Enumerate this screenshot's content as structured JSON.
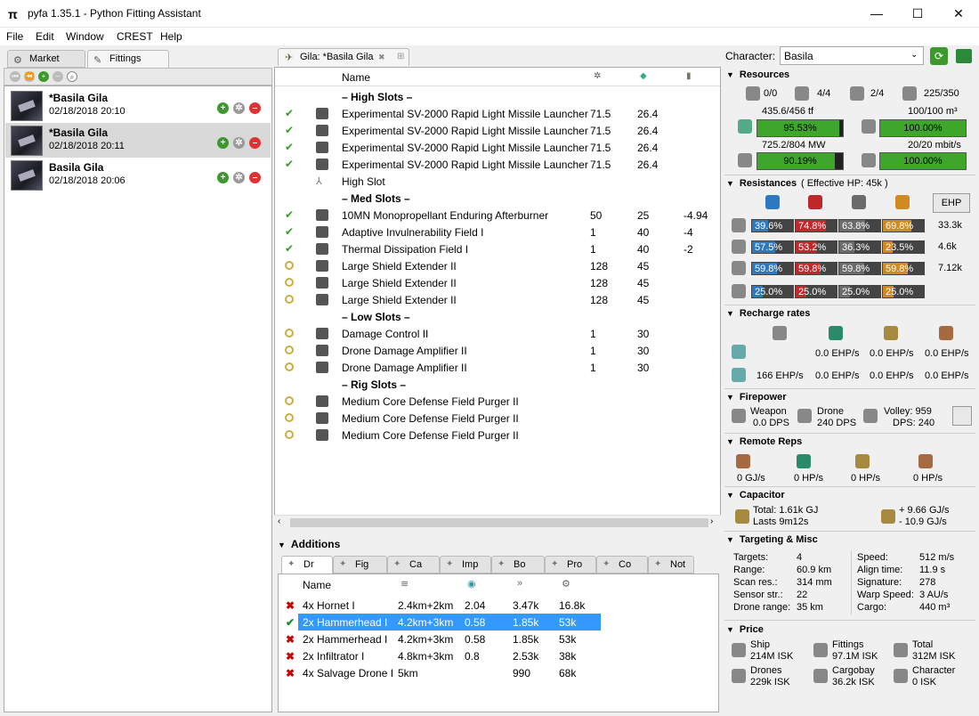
{
  "window": {
    "title": "pyfa 1.35.1 - Python Fitting Assistant",
    "minimize": "—",
    "maximize": "☐",
    "close": "✕"
  },
  "menu": [
    "File",
    "Edit",
    "Window",
    "CREST",
    "Help"
  ],
  "left": {
    "tabs": [
      "Market",
      "Fittings"
    ],
    "fits": [
      {
        "name": "*Basila Gila",
        "date": "02/18/2018 20:10"
      },
      {
        "name": "*Basila Gila",
        "date": "02/18/2018 20:11"
      },
      {
        "name": "Basila Gila",
        "date": "02/18/2018 20:06"
      }
    ]
  },
  "fit_tab": {
    "label": "Gila: *Basila Gila"
  },
  "modules": {
    "header": {
      "name": "Name"
    },
    "rows": [
      {
        "type": "header",
        "name": "– High Slots –"
      },
      {
        "state": "on",
        "name": "Experimental SV-2000 Rapid Light Missile Launcher",
        "c1": "71.5",
        "c2": "26.4",
        "c3": ""
      },
      {
        "state": "on",
        "name": "Experimental SV-2000 Rapid Light Missile Launcher",
        "c1": "71.5",
        "c2": "26.4",
        "c3": ""
      },
      {
        "state": "on",
        "name": "Experimental SV-2000 Rapid Light Missile Launcher",
        "c1": "71.5",
        "c2": "26.4",
        "c3": ""
      },
      {
        "state": "on",
        "name": "Experimental SV-2000 Rapid Light Missile Launcher",
        "c1": "71.5",
        "c2": "26.4",
        "c3": ""
      },
      {
        "state": "empty",
        "name": "High Slot",
        "c1": "",
        "c2": "",
        "c3": ""
      },
      {
        "type": "header",
        "name": "– Med Slots –"
      },
      {
        "state": "on",
        "name": "10MN Monopropellant Enduring Afterburner",
        "c1": "50",
        "c2": "25",
        "c3": "-4.94"
      },
      {
        "state": "on",
        "name": "Adaptive Invulnerability Field I",
        "c1": "1",
        "c2": "40",
        "c3": "-4"
      },
      {
        "state": "on",
        "name": "Thermal Dissipation Field I",
        "c1": "1",
        "c2": "40",
        "c3": "-2"
      },
      {
        "state": "off",
        "name": "Large Shield Extender II",
        "c1": "128",
        "c2": "45",
        "c3": ""
      },
      {
        "state": "off",
        "name": "Large Shield Extender II",
        "c1": "128",
        "c2": "45",
        "c3": ""
      },
      {
        "state": "off",
        "name": "Large Shield Extender II",
        "c1": "128",
        "c2": "45",
        "c3": ""
      },
      {
        "type": "header",
        "name": "– Low Slots –"
      },
      {
        "state": "off",
        "name": "Damage Control II",
        "c1": "1",
        "c2": "30",
        "c3": ""
      },
      {
        "state": "off",
        "name": "Drone Damage Amplifier II",
        "c1": "1",
        "c2": "30",
        "c3": ""
      },
      {
        "state": "off",
        "name": "Drone Damage Amplifier II",
        "c1": "1",
        "c2": "30",
        "c3": ""
      },
      {
        "type": "header",
        "name": "– Rig Slots –"
      },
      {
        "state": "off",
        "name": "Medium Core Defense Field Purger II",
        "c1": "",
        "c2": "",
        "c3": ""
      },
      {
        "state": "off",
        "name": "Medium Core Defense Field Purger II",
        "c1": "",
        "c2": "",
        "c3": ""
      },
      {
        "state": "off",
        "name": "Medium Core Defense Field Purger II",
        "c1": "",
        "c2": "",
        "c3": ""
      }
    ]
  },
  "additions": {
    "title": "Additions",
    "tabs": [
      "Dr",
      "Fig",
      "Ca",
      "Imp",
      "Bo",
      "Pro",
      "Co",
      "Not"
    ],
    "header": {
      "name": "Name"
    },
    "rows": [
      {
        "name": "4x Hornet I",
        "range": "2.4km+2km",
        "speed": "2.04",
        "a": "3.47k",
        "b": "16.8k",
        "selected": false
      },
      {
        "name": "2x Hammerhead I",
        "range": "4.2km+3km",
        "speed": "0.58",
        "a": "1.85k",
        "b": "53k",
        "selected": true
      },
      {
        "name": "2x Hammerhead I",
        "range": "4.2km+3km",
        "speed": "0.58",
        "a": "1.85k",
        "b": "53k",
        "selected": false
      },
      {
        "name": "2x Infiltrator I",
        "range": "4.8km+3km",
        "speed": "0.8",
        "a": "2.53k",
        "b": "38k",
        "selected": false
      },
      {
        "name": "4x Salvage Drone I",
        "range": "5km",
        "speed": "",
        "a": "990",
        "b": "68k",
        "selected": false
      }
    ]
  },
  "right": {
    "character_label": "Character:",
    "character": "Basila",
    "resources": {
      "title": "Resources",
      "hardpoints": [
        "0/0",
        "4/4",
        "2/4",
        "225/350"
      ],
      "cpu": {
        "text": "435.6/456 tf",
        "pct": "95.53%",
        "frac": 0.955
      },
      "drone_bay": {
        "text": "100/100 m³",
        "pct": "100.00%",
        "frac": 1.0
      },
      "pg": {
        "text": "725.2/804 MW",
        "pct": "90.19%",
        "frac": 0.902
      },
      "bandwidth": {
        "text": "20/20 mbit/s",
        "pct": "100.00%",
        "frac": 1.0
      }
    },
    "resistances": {
      "title": "Resistances",
      "ehp_note": "( Effective HP: 45k )",
      "ehp_button": "EHP",
      "rows": [
        {
          "vals": [
            "39.6%",
            "74.8%",
            "63.8%",
            "69.8%"
          ],
          "fracs": [
            0.396,
            0.748,
            0.638,
            0.698
          ],
          "hp": "33.3k"
        },
        {
          "vals": [
            "57.5%",
            "53.2%",
            "36.3%",
            "23.5%"
          ],
          "fracs": [
            0.575,
            0.532,
            0.363,
            0.235
          ],
          "hp": "4.6k"
        },
        {
          "vals": [
            "59.8%",
            "59.8%",
            "59.8%",
            "59.8%"
          ],
          "fracs": [
            0.598,
            0.598,
            0.598,
            0.598
          ],
          "hp": "7.12k"
        },
        {
          "vals": [
            "25.0%",
            "25.0%",
            "25.0%",
            "25.0%"
          ],
          "fracs": [
            0.25,
            0.25,
            0.25,
            0.25
          ],
          "hp": ""
        }
      ],
      "colors": [
        "#2c79c0",
        "#c0282c",
        "#6b6b6b",
        "#d08a20"
      ]
    },
    "recharge": {
      "title": "Recharge rates",
      "row1": [
        "0.0 EHP/s",
        "0.0 EHP/s",
        "0.0 EHP/s"
      ],
      "row2": [
        "166 EHP/s",
        "0.0 EHP/s",
        "0.0 EHP/s",
        "0.0 EHP/s"
      ]
    },
    "firepower": {
      "title": "Firepower",
      "weapon_label": "Weapon",
      "weapon_dps": "0.0 DPS",
      "drone_label": "Drone",
      "drone_dps": "240 DPS",
      "volley": "Volley: 959",
      "dps": "DPS: 240"
    },
    "remote_reps": {
      "title": "Remote Reps",
      "vals": [
        "0 GJ/s",
        "0 HP/s",
        "0 HP/s",
        "0 HP/s"
      ]
    },
    "capacitor": {
      "title": "Capacitor",
      "total": "Total: 1.61k GJ",
      "lasts": "Lasts 9m12s",
      "plus": "+ 9.66 GJ/s",
      "minus": "- 10.9 GJ/s"
    },
    "targeting": {
      "title": "Targeting & Misc",
      "left": [
        [
          "Targets:",
          "4"
        ],
        [
          "Range:",
          "60.9 km"
        ],
        [
          "Scan res.:",
          "314 mm"
        ],
        [
          "Sensor str.:",
          "22"
        ],
        [
          "Drone range:",
          "35 km"
        ]
      ],
      "right": [
        [
          "Speed:",
          "512 m/s"
        ],
        [
          "Align time:",
          "11.9 s"
        ],
        [
          "Signature:",
          "278"
        ],
        [
          "Warp Speed:",
          "3 AU/s"
        ],
        [
          "Cargo:",
          "440 m³"
        ]
      ]
    },
    "price": {
      "title": "Price",
      "items": [
        {
          "label": "Ship",
          "value": "214M ISK"
        },
        {
          "label": "Fittings",
          "value": "97.1M ISK"
        },
        {
          "label": "Total",
          "value": "312M ISK"
        },
        {
          "label": "Drones",
          "value": "229k ISK"
        },
        {
          "label": "Cargobay",
          "value": "36.2k ISK"
        },
        {
          "label": "Character",
          "value": "0 ISK"
        }
      ]
    }
  }
}
